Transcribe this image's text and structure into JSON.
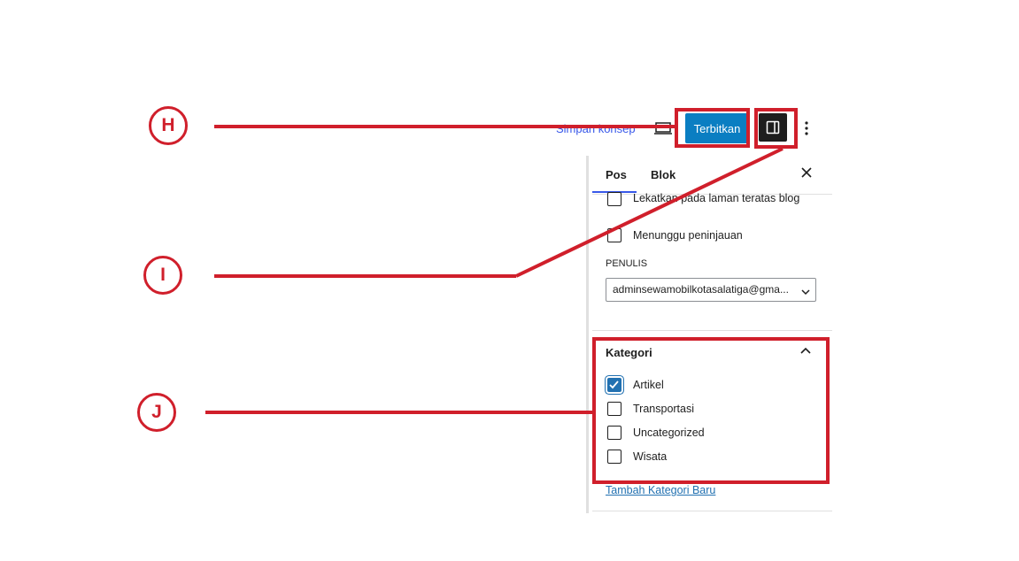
{
  "toolbar": {
    "save_draft_label": "Simpan konsep",
    "publish_label": "Terbitkan",
    "preview_icon": "preview-icon",
    "settings_icon": "sidebar-toggle-icon",
    "more_icon": "more-vertical-icon"
  },
  "sidebar": {
    "tabs": [
      {
        "label": "Pos",
        "active": true
      },
      {
        "label": "Blok",
        "active": false
      }
    ],
    "close_icon": "close-icon",
    "sticky_label": "Lekatkan pada laman teratas blog",
    "pending_label": "Menunggu peninjauan",
    "author": {
      "section_label": "PENULIS",
      "selected": "adminsewamobilkotasalatiga@gma..."
    },
    "categories": {
      "title": "Kategori",
      "items": [
        {
          "label": "Artikel",
          "checked": true
        },
        {
          "label": "Transportasi",
          "checked": false
        },
        {
          "label": "Uncategorized",
          "checked": false
        },
        {
          "label": "Wisata",
          "checked": false
        }
      ],
      "add_new_label": "Tambah Kategori Baru"
    }
  },
  "annotations": {
    "markers": [
      "H",
      "I",
      "J"
    ],
    "color": "#d01f2b"
  },
  "colors": {
    "primary": "#0a7ec2",
    "accent": "#2271b1",
    "tab_highlight": "#3858e9"
  }
}
